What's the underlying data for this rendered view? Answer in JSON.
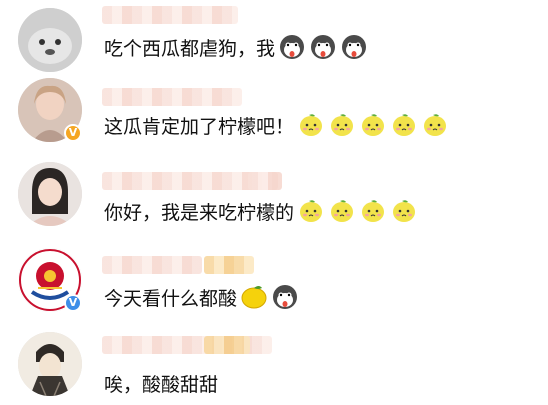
{
  "comments": [
    {
      "text": "吃个西瓜都虐狗，我",
      "emojis": [
        "husky-icon",
        "husky-icon",
        "husky-icon"
      ],
      "verified": "none"
    },
    {
      "text": "这瓜肯定加了柠檬吧！",
      "emojis": [
        "lemon-face-icon",
        "lemon-face-icon",
        "lemon-face-icon",
        "lemon-face-icon",
        "lemon-face-icon"
      ],
      "verified": "gold"
    },
    {
      "text": "你好，我是来吃柠檬的",
      "emojis": [
        "lemon-face-icon",
        "lemon-face-icon",
        "lemon-face-icon",
        "lemon-face-icon"
      ],
      "verified": "none"
    },
    {
      "text": "今天看什么都酸",
      "emojis": [
        "lemon-icon",
        "husky-icon"
      ],
      "verified": "blue"
    },
    {
      "text": "唉，酸酸甜甜",
      "emojis": [],
      "verified": "none"
    }
  ],
  "colors": {
    "verified_gold": "#f5a623",
    "verified_blue": "#3d8ee8",
    "text": "#111111"
  }
}
